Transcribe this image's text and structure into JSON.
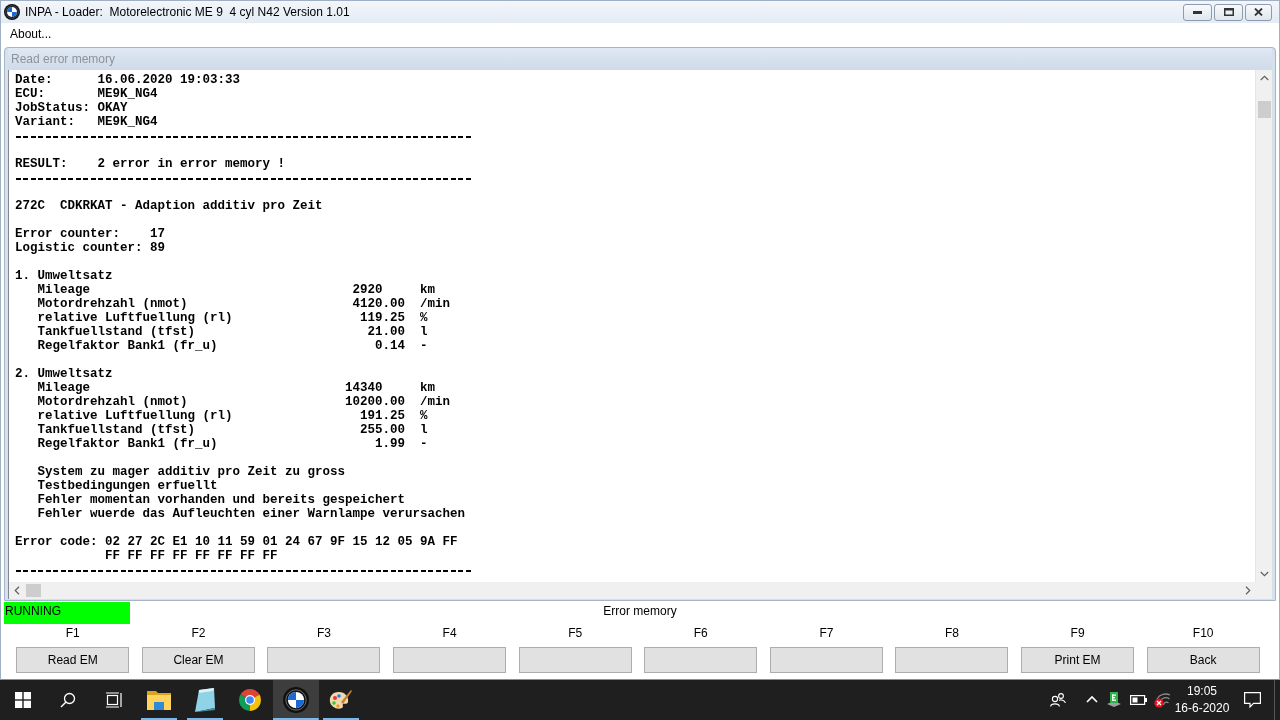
{
  "window": {
    "title": "INPA - Loader:  Motorelectronic ME 9  4 cyl N42 Version 1.01"
  },
  "menu": [
    {
      "label": "About..."
    }
  ],
  "child_window": {
    "title": "Read error memory"
  },
  "report": {
    "header": [
      {
        "label": "Date:",
        "value": "16.06.2020 19:03:33"
      },
      {
        "label": "ECU:",
        "value": "ME9K_NG4"
      },
      {
        "label": "JobStatus:",
        "value": "OKAY"
      },
      {
        "label": "Variant:",
        "value": "ME9K_NG4"
      }
    ],
    "result": {
      "label": "RESULT:",
      "value": "2 error in error memory !"
    },
    "fault": {
      "code": "272C",
      "title": "CDKRKAT - Adaption additiv pro Zeit",
      "counters": [
        {
          "label": "Error counter:",
          "value": "17"
        },
        {
          "label": "Logistic counter:",
          "value": "89"
        }
      ],
      "environment_sets": [
        {
          "title": "1. Umweltsatz",
          "rows": [
            {
              "name": "Mileage",
              "value": "2920",
              "unit": "km",
              "kind": "integer"
            },
            {
              "name": "Motordrehzahl (nmot)",
              "value": "4120.00",
              "unit": "/min",
              "kind": "decimal"
            },
            {
              "name": "relative Luftfuellung (rl)",
              "value": "119.25",
              "unit": "%",
              "kind": "decimal"
            },
            {
              "name": "Tankfuellstand (tfst)",
              "value": "21.00",
              "unit": "l",
              "kind": "decimal"
            },
            {
              "name": "Regelfaktor Bank1 (fr_u)",
              "value": "0.14",
              "unit": "-",
              "kind": "decimal"
            }
          ]
        },
        {
          "title": "2. Umweltsatz",
          "rows": [
            {
              "name": "Mileage",
              "value": "14340",
              "unit": "km",
              "kind": "integer"
            },
            {
              "name": "Motordrehzahl (nmot)",
              "value": "10200.00",
              "unit": "/min",
              "kind": "decimal"
            },
            {
              "name": "relative Luftfuellung (rl)",
              "value": "191.25",
              "unit": "%",
              "kind": "decimal"
            },
            {
              "name": "Tankfuellstand (tfst)",
              "value": "255.00",
              "unit": "l",
              "kind": "decimal"
            },
            {
              "name": "Regelfaktor Bank1 (fr_u)",
              "value": "1.99",
              "unit": "-",
              "kind": "decimal"
            }
          ]
        }
      ],
      "conditions": [
        "System zu mager additiv pro Zeit zu gross",
        "Testbedingungen erfuellt",
        "Fehler momentan vorhanden und bereits gespeichert",
        "Fehler wuerde das Aufleuchten einer Warnlampe verursachen"
      ],
      "error_code": {
        "label": "Error code:",
        "lines": [
          "02 27 2C E1 10 11 59 01 24 67 9F 15 12 05 9A FF",
          "FF FF FF FF FF FF FF FF"
        ]
      }
    }
  },
  "status": {
    "label": "RUNNING"
  },
  "screen_title": "Error memory",
  "function_keys": [
    {
      "key": "F1",
      "label": "Read EM"
    },
    {
      "key": "F2",
      "label": "Clear EM"
    },
    {
      "key": "F3"
    },
    {
      "key": "F4"
    },
    {
      "key": "F5"
    },
    {
      "key": "F6"
    },
    {
      "key": "F7"
    },
    {
      "key": "F8"
    },
    {
      "key": "F9",
      "label": "Print EM"
    },
    {
      "key": "F10",
      "label": "Back"
    }
  ],
  "taskbar": {
    "apps": [
      {
        "kind": "folder",
        "running": true,
        "selected": false
      },
      {
        "kind": "notepad",
        "running": true,
        "selected": false
      },
      {
        "kind": "browser",
        "running": false,
        "selected": false
      },
      {
        "kind": "roundel",
        "running": true,
        "selected": true
      },
      {
        "kind": "palette",
        "running": true,
        "selected": false
      }
    ],
    "clock": {
      "time": "19:05",
      "date": "16-6-2020"
    }
  }
}
